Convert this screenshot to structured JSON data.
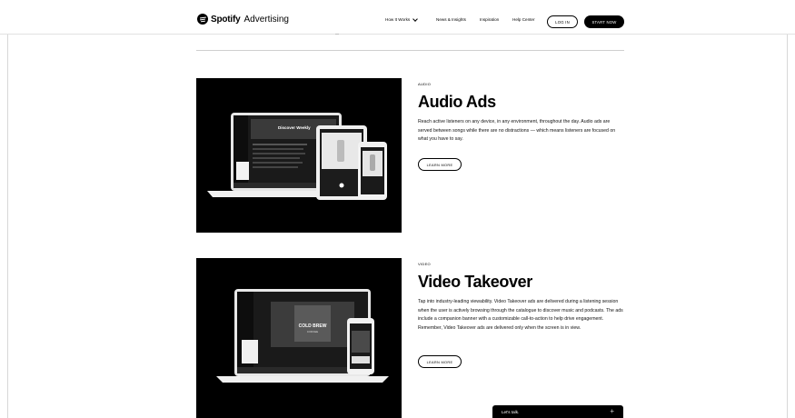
{
  "header": {
    "brand": "Spotify",
    "brand_sub": "Advertising",
    "nav": [
      {
        "label": "How It Works"
      },
      {
        "label": "News & Insights"
      },
      {
        "label": "Inspiration"
      },
      {
        "label": "Help Center"
      }
    ],
    "login_label": "LOG IN",
    "start_label": "START NOW"
  },
  "sections": [
    {
      "eyebrow": "AUDIO",
      "title": "Audio Ads",
      "description": "Reach active listeners on any device, in any environment, throughout the day. Audio ads are served between songs while there are no distractions — which means listeners are focused on what you have to say.",
      "cta": "LEARN MORE",
      "screen_title": "Discover Weekly"
    },
    {
      "eyebrow": "VIDEO",
      "title": "Video Takeover",
      "description": "Tap into industry-leading viewability. Video Takeover ads are delivered during a listening session when the user is actively browsing through the catalogue to discover music and podcasts. The ads include a companion banner with a customizable call-to-action to help drive engagement. Remember, Video Takeover ads are delivered only when the screen is in view.",
      "cta": "LEARN MORE",
      "screen_title": "COLD BREW",
      "screen_sub": "COFFEE"
    }
  ],
  "chat": {
    "label": "Let's talk.",
    "icon": "plus-icon"
  },
  "colors": {
    "background": "#ffffff",
    "ink": "#000000",
    "divider": "#cfcfcf"
  }
}
